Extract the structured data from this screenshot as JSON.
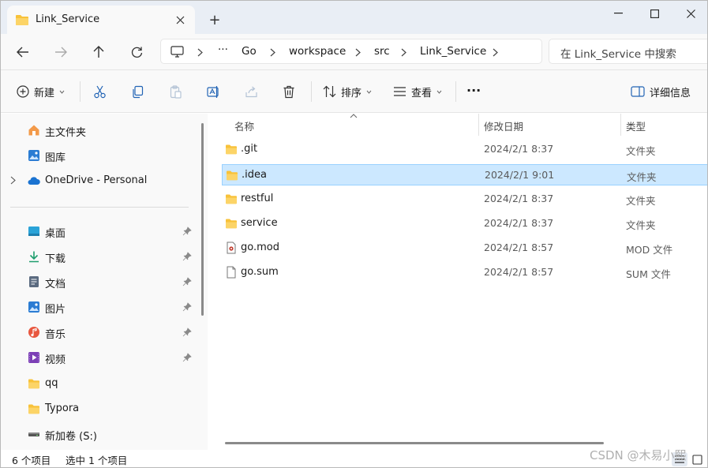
{
  "window": {
    "tab_title": "Link_Service",
    "new_tab_symbol": "+"
  },
  "address": {
    "path": [
      "Go",
      "workspace",
      "src",
      "Link_Service"
    ],
    "overflow": "···"
  },
  "search": {
    "placeholder": "在 Link_Service 中搜索"
  },
  "toolbar": {
    "new_label": "新建",
    "sort_label": "排序",
    "view_label": "查看",
    "more_label": "···",
    "details_label": "详细信息"
  },
  "sidebar": {
    "items": [
      {
        "label": "主文件夹",
        "icon": "home-icon"
      },
      {
        "label": "图库",
        "icon": "gallery-icon"
      },
      {
        "label": "OneDrive - Personal",
        "icon": "onedrive-cloud-icon"
      }
    ],
    "quick": [
      {
        "label": "桌面",
        "icon": "desktop-icon",
        "pinned": true
      },
      {
        "label": "下载",
        "icon": "download-icon",
        "pinned": true
      },
      {
        "label": "文档",
        "icon": "documents-icon",
        "pinned": true
      },
      {
        "label": "图片",
        "icon": "pictures-icon",
        "pinned": true
      },
      {
        "label": "音乐",
        "icon": "music-icon",
        "pinned": true
      },
      {
        "label": "视频",
        "icon": "videos-icon",
        "pinned": true
      },
      {
        "label": "qq",
        "icon": "folder-icon",
        "pinned": false
      },
      {
        "label": "Typora",
        "icon": "folder-icon",
        "pinned": false
      },
      {
        "label": "新加卷 (S:)",
        "icon": "drive-icon",
        "pinned": false
      }
    ]
  },
  "list": {
    "columns": {
      "name": "名称",
      "date": "修改日期",
      "type": "类型"
    },
    "rows": [
      {
        "name": ".git",
        "date": "2024/2/1 8:37",
        "type": "文件夹",
        "icon": "folder-icon",
        "selected": false
      },
      {
        "name": ".idea",
        "date": "2024/2/1 9:01",
        "type": "文件夹",
        "icon": "folder-icon",
        "selected": true
      },
      {
        "name": "restful",
        "date": "2024/2/1 8:37",
        "type": "文件夹",
        "icon": "folder-icon",
        "selected": false
      },
      {
        "name": "service",
        "date": "2024/2/1 8:37",
        "type": "文件夹",
        "icon": "folder-icon",
        "selected": false
      },
      {
        "name": "go.mod",
        "date": "2024/2/1 8:57",
        "type": "MOD 文件",
        "icon": "mod-file-icon",
        "selected": false
      },
      {
        "name": "go.sum",
        "date": "2024/2/1 8:57",
        "type": "SUM 文件",
        "icon": "file-icon",
        "selected": false
      }
    ]
  },
  "status": {
    "count": "6 个项目",
    "selected": "选中 1 个项目"
  },
  "watermark": "CSDN @木易小熙",
  "colors": {
    "accent": "#0067c0",
    "selection_bg": "#cce8ff",
    "folder_yellow": "#f8c23a"
  }
}
